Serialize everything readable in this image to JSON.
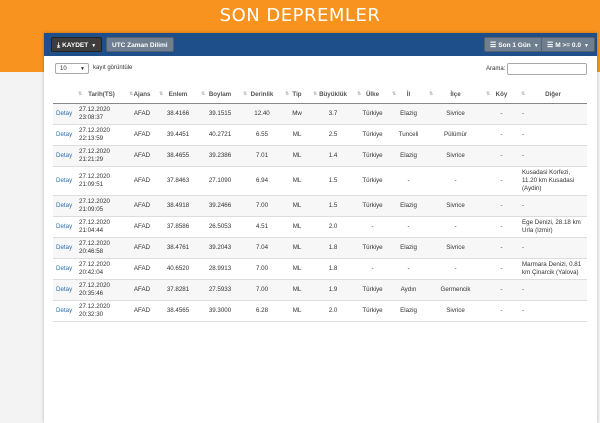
{
  "page_title": "SON DEPREMLER",
  "toolbar": {
    "save_label": "KAYDET",
    "utc_label": "UTC Zaman Dilimi",
    "period_label": "Son 1 Gün",
    "magnitude_label": "M >= 0.0"
  },
  "controls": {
    "page_size": "10",
    "page_size_label": "kayıt görüntüle",
    "search_label": "Arama:"
  },
  "columns": [
    "Tarih(TS)",
    "Ajans",
    "Enlem",
    "Boylam",
    "Derinlik",
    "Tip",
    "Büyüklük",
    "Ülke",
    "İl",
    "İlçe",
    "Köy",
    "Diğer"
  ],
  "rows": [
    {
      "link": "Detay",
      "date": "27.12.2020",
      "time": "23:08:37",
      "agency": "AFAD",
      "lat": "38.4166",
      "lon": "39.1515",
      "depth": "12.40",
      "type": "Mw",
      "mag": "3.7",
      "country": "Türkiye",
      "city": "Elazig",
      "district": "Sivrice",
      "village": "-",
      "other": "-"
    },
    {
      "link": "Detay",
      "date": "27.12.2020",
      "time": "22:13:59",
      "agency": "AFAD",
      "lat": "39.4451",
      "lon": "40.2721",
      "depth": "6.55",
      "type": "ML",
      "mag": "2.5",
      "country": "Türkiye",
      "city": "Tunceli",
      "district": "Pülümür",
      "village": "-",
      "other": "-"
    },
    {
      "link": "Detay",
      "date": "27.12.2020",
      "time": "21:21:29",
      "agency": "AFAD",
      "lat": "38.4655",
      "lon": "39.2386",
      "depth": "7.01",
      "type": "ML",
      "mag": "1.4",
      "country": "Türkiye",
      "city": "Elazig",
      "district": "Sivrice",
      "village": "-",
      "other": "-"
    },
    {
      "link": "Detay",
      "date": "27.12.2020",
      "time": "21:09:51",
      "agency": "AFAD",
      "lat": "37.8463",
      "lon": "27.1090",
      "depth": "6.94",
      "type": "ML",
      "mag": "1.5",
      "country": "Türkiye",
      "city": "-",
      "district": "-",
      "village": "-",
      "other": "Kusadasi Korfezi, 11.20 km Kusadasi (Aydin)"
    },
    {
      "link": "Detay",
      "date": "27.12.2020",
      "time": "21:09:05",
      "agency": "AFAD",
      "lat": "38.4918",
      "lon": "39.2466",
      "depth": "7.00",
      "type": "ML",
      "mag": "1.5",
      "country": "Türkiye",
      "city": "Elazig",
      "district": "Sivrice",
      "village": "-",
      "other": "-"
    },
    {
      "link": "Detay",
      "date": "27.12.2020",
      "time": "21:04:44",
      "agency": "AFAD",
      "lat": "37.8586",
      "lon": "26.5053",
      "depth": "4.51",
      "type": "ML",
      "mag": "2.0",
      "country": "-",
      "city": "-",
      "district": "-",
      "village": "-",
      "other": "Ege Denizi, 28.18 km Urla (Izmir)"
    },
    {
      "link": "Detay",
      "date": "27.12.2020",
      "time": "20:46:58",
      "agency": "AFAD",
      "lat": "38.4761",
      "lon": "39.2043",
      "depth": "7.04",
      "type": "ML",
      "mag": "1.8",
      "country": "Türkiye",
      "city": "Elazig",
      "district": "Sivrice",
      "village": "-",
      "other": "-"
    },
    {
      "link": "Detay",
      "date": "27.12.2020",
      "time": "20:42:04",
      "agency": "AFAD",
      "lat": "40.6520",
      "lon": "28.9913",
      "depth": "7.00",
      "type": "ML",
      "mag": "1.8",
      "country": "-",
      "city": "-",
      "district": "-",
      "village": "-",
      "other": "Marmara Denizi, 0.81 km Çinarcik (Yalova)"
    },
    {
      "link": "Detay",
      "date": "27.12.2020",
      "time": "20:35:46",
      "agency": "AFAD",
      "lat": "37.8281",
      "lon": "27.5933",
      "depth": "7.00",
      "type": "ML",
      "mag": "1.9",
      "country": "Türkiye",
      "city": "Aydın",
      "district": "Germencik",
      "village": "-",
      "other": "-"
    },
    {
      "link": "Detay",
      "date": "27.12.2020",
      "time": "20:32:30",
      "agency": "AFAD",
      "lat": "38.4565",
      "lon": "39.3000",
      "depth": "6.28",
      "type": "ML",
      "mag": "2.0",
      "country": "Türkiye",
      "city": "Elazig",
      "district": "Sivrice",
      "village": "-",
      "other": "-"
    }
  ],
  "icons": {
    "download": "download-icon",
    "sort": "sort-icon",
    "caret": "caret-down-icon",
    "menu": "list-icon"
  }
}
